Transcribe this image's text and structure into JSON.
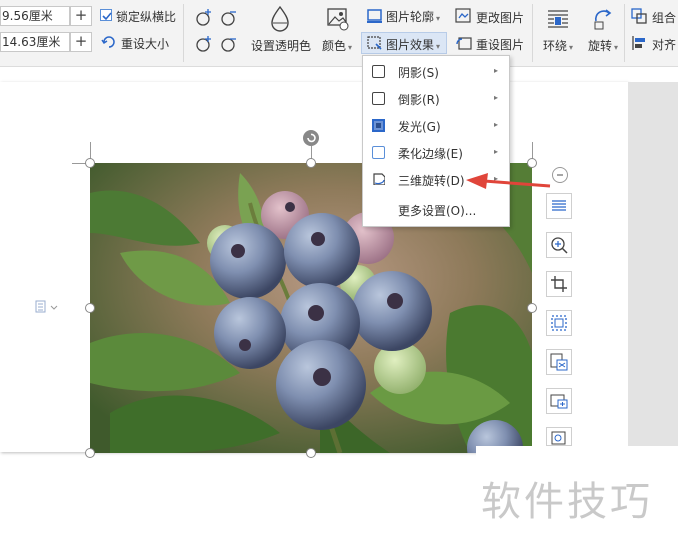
{
  "ribbon": {
    "width_value": "9.56厘米",
    "height_value": "14.63厘米",
    "plus": "+",
    "lock_ratio_label": "锁定纵横比",
    "lock_ratio_checked": true,
    "reset_size_label": "重设大小",
    "set_transparent_label": "设置透明色",
    "color_label": "颜色",
    "picture_outline_label": "图片轮廓",
    "change_picture_label": "更改图片",
    "picture_effects_label": "图片效果",
    "reset_picture_label": "重设图片",
    "wrap_label": "环绕",
    "rotate_label": "旋转",
    "group_label": "组合",
    "align_label": "对齐",
    "dropdown_glyph": "▾"
  },
  "effects_menu": {
    "items": [
      {
        "label": "阴影(S)",
        "icon": "shadow-icon",
        "has_submenu": true
      },
      {
        "label": "倒影(R)",
        "icon": "reflection-icon",
        "has_submenu": true
      },
      {
        "label": "发光(G)",
        "icon": "glow-icon",
        "has_submenu": true
      },
      {
        "label": "柔化边缘(E)",
        "icon": "soft-edge-icon",
        "has_submenu": true
      },
      {
        "label": "三维旋转(D)",
        "icon": "3d-rotation-icon",
        "has_submenu": true
      },
      {
        "label": "更多设置(O)...",
        "icon": "",
        "has_submenu": false
      }
    ],
    "submenu_arrow": "▸"
  },
  "watermark": "软件技巧",
  "colors": {
    "accent_blue": "#2b67c9",
    "annotation_arrow": "#e0453a",
    "ribbon_bg": "#f3f3f3"
  }
}
